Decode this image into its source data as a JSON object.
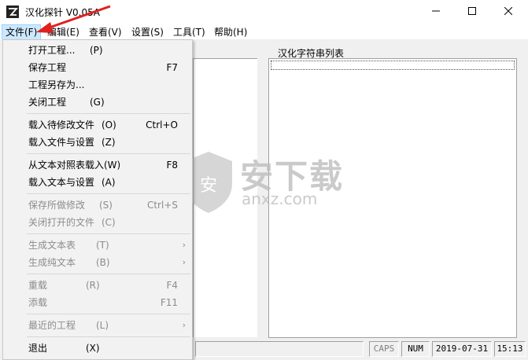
{
  "window": {
    "title": "汉化探针 V0.05A",
    "icons": {
      "app": "app-logo-icon",
      "minimize": "minimize-icon",
      "maximize": "maximize-icon",
      "close": "close-icon"
    }
  },
  "menubar": {
    "items": [
      {
        "label": "文件(F)"
      },
      {
        "label": "编辑(E)"
      },
      {
        "label": "查看(V)"
      },
      {
        "label": "设置(S)"
      },
      {
        "label": "工具(T)"
      },
      {
        "label": "帮助(H)"
      }
    ]
  },
  "file_menu": {
    "items": [
      {
        "label": "打开工程...",
        "accel": "(P)",
        "shortcut": ""
      },
      {
        "label": "保存工程",
        "accel": "",
        "shortcut": "F7"
      },
      {
        "label": "工程另存为...",
        "accel": "",
        "shortcut": ""
      },
      {
        "label": "关闭工程",
        "accel": "(G)",
        "shortcut": ""
      },
      {
        "label": "载入待修改文件",
        "accel": "(O)",
        "shortcut": "Ctrl+O"
      },
      {
        "label": "载入文件与设置",
        "accel": "(Z)",
        "shortcut": ""
      },
      {
        "label": "从文本对照表载入(W)",
        "accel": "",
        "shortcut": "F8"
      },
      {
        "label": "载入文本与设置",
        "accel": "(A)",
        "shortcut": ""
      },
      {
        "label": "保存所做修改",
        "accel": "(S)",
        "shortcut": "Ctrl+S"
      },
      {
        "label": "关闭打开的文件",
        "accel": "(C)",
        "shortcut": ""
      },
      {
        "label": "生成文本表",
        "accel": "(T)",
        "shortcut": ""
      },
      {
        "label": "生成纯文本",
        "accel": "(B)",
        "shortcut": ""
      },
      {
        "label": "重载",
        "accel": "(R)",
        "shortcut": "F4"
      },
      {
        "label": "添载",
        "accel": "",
        "shortcut": "F11"
      },
      {
        "label": "最近的工程",
        "accel": "(L)",
        "shortcut": ""
      },
      {
        "label": "退出",
        "accel": "(X)",
        "shortcut": ""
      }
    ],
    "submenu_arrow": "›"
  },
  "main": {
    "string_list_label": "汉化字符串列表"
  },
  "watermark": {
    "brand_cn": "安下载",
    "brand_en": "anxz.com"
  },
  "statusbar": {
    "caps": "CAPS",
    "num": "NUM",
    "date": "2019-07-31",
    "time": "15:13"
  },
  "colors": {
    "menu_highlight": "#cce8ff",
    "arrow": "#e02020"
  }
}
